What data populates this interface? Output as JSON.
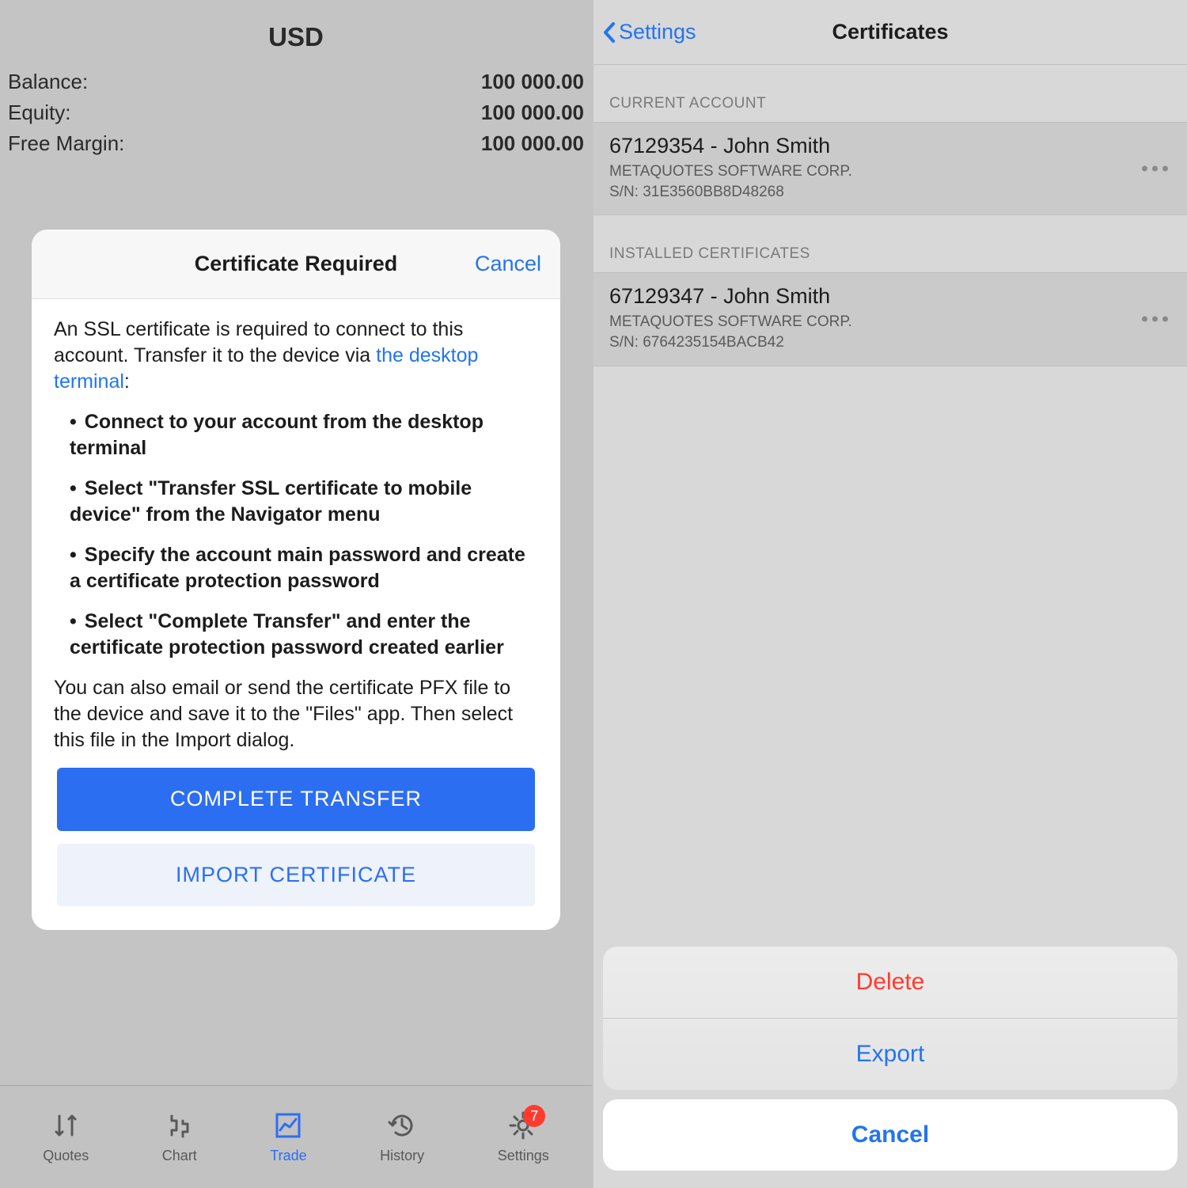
{
  "left": {
    "currency": "USD",
    "stats": {
      "balance_label": "Balance:",
      "balance_value": "100 000.00",
      "equity_label": "Equity:",
      "equity_value": "100 000.00",
      "freemargin_label": "Free Margin:",
      "freemargin_value": "100 000.00"
    },
    "sheet": {
      "title": "Certificate Required",
      "cancel": "Cancel",
      "p1_before": "An SSL certificate is required to connect to this account. Transfer it to the device via ",
      "p1_link": "the desktop terminal",
      "p1_after": ":",
      "b1": "Connect to your account from the desktop terminal",
      "b2": "Select \"Transfer SSL certificate to mobile device\" from the Navigator menu",
      "b3": "Specify the account main password and create a certificate protection password",
      "b4": "Select \"Complete Transfer\" and enter the certificate protection password created earlier",
      "p2": "You can also email or send the certificate PFX file to the device and save it to the \"Files\" app. Then select this file in the Import dialog.",
      "btn_primary": "COMPLETE TRANSFER",
      "btn_secondary": "IMPORT CERTIFICATE"
    },
    "tabs": {
      "quotes": "Quotes",
      "chart": "Chart",
      "trade": "Trade",
      "history": "History",
      "settings": "Settings",
      "settings_badge": "7"
    }
  },
  "right": {
    "nav": {
      "back": "Settings",
      "title": "Certificates"
    },
    "section1": "CURRENT ACCOUNT",
    "cert1": {
      "title": "67129354 - John Smith",
      "company": "METAQUOTES SOFTWARE CORP.",
      "sn": "S/N: 31E3560BB8D48268"
    },
    "section2": "INSTALLED CERTIFICATES",
    "cert2": {
      "title": "67129347 - John Smith",
      "company": "METAQUOTES SOFTWARE CORP.",
      "sn": "S/N: 6764235154BACB42"
    },
    "actions": {
      "delete": "Delete",
      "export": "Export",
      "cancel": "Cancel"
    }
  }
}
